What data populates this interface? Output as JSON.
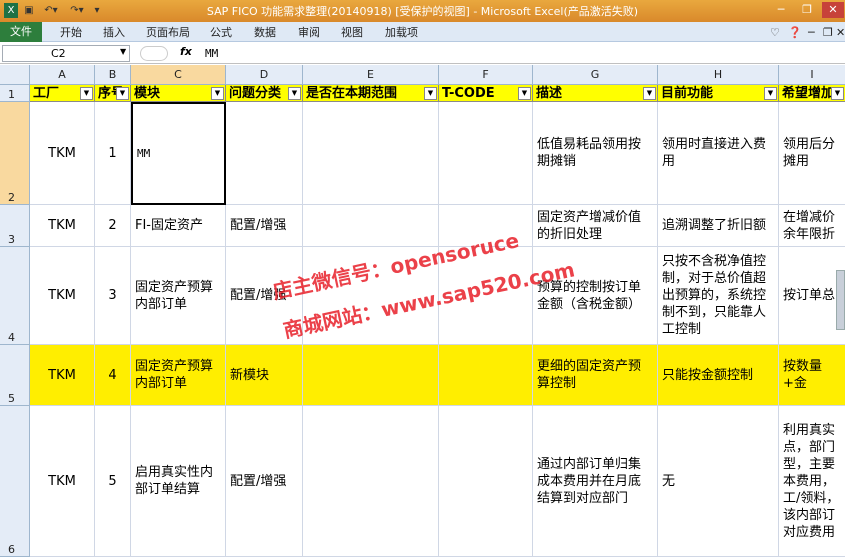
{
  "window": {
    "title": "SAP FICO 功能需求整理(20140918)  [受保护的视图] - Microsoft Excel(产品激活失败)"
  },
  "ribbon": {
    "file": "文件",
    "tabs": [
      "开始",
      "插入",
      "页面布局",
      "公式",
      "数据",
      "审阅",
      "视图",
      "加载项"
    ]
  },
  "formula_bar": {
    "name_box": "C2",
    "fx": "fx",
    "content": "MM"
  },
  "columns": [
    "A",
    "B",
    "C",
    "D",
    "E",
    "F",
    "G",
    "H",
    "I"
  ],
  "header_row": {
    "num": "1",
    "cells": [
      "工厂",
      "序号",
      "模块",
      "问题分类",
      "是否在本期范围",
      "T-CODE",
      "描述",
      "目前功能",
      "希望增加"
    ]
  },
  "rows": [
    {
      "num": "2",
      "cells": [
        "TKM",
        "1",
        "MM",
        "",
        "",
        "",
        "低值易耗品领用按期摊销",
        "领用时直接进入费用",
        "领用后分摊用"
      ]
    },
    {
      "num": "3",
      "cells": [
        "TKM",
        "2",
        "FI-固定资产",
        "配置/增强",
        "",
        "",
        "固定资产增减价值的折旧处理",
        "追溯调整了折旧额",
        "在增减价余年限折"
      ]
    },
    {
      "num": "4",
      "cells": [
        "TKM",
        "3",
        "固定资产预算内部订单",
        "配置/增强",
        "",
        "",
        "预算的控制按订单金额（含税金额）",
        "只按不含税净值控制，对于总价值超出预算的，系统控制不到，只能靠人工控制",
        "按订单总"
      ]
    },
    {
      "num": "5",
      "cells": [
        "TKM",
        "4",
        "固定资产预算内部订单",
        "新模块",
        "",
        "",
        "更细的固定资产预算控制",
        "只能按金额控制",
        "按数量+金"
      ]
    },
    {
      "num": "6",
      "cells": [
        "TKM",
        "5",
        "启用真实性内部订单结算",
        "配置/增强",
        "",
        "",
        "通过内部订单归集成本费用并在月底结算到对应部门",
        "无",
        "利用真实点，部门型，主要本费用，工/领料，该内部订对应费用"
      ]
    }
  ],
  "watermark": {
    "line1": "店主微信号：opensoruce",
    "line2": "商城网站：www.sap520.com"
  }
}
